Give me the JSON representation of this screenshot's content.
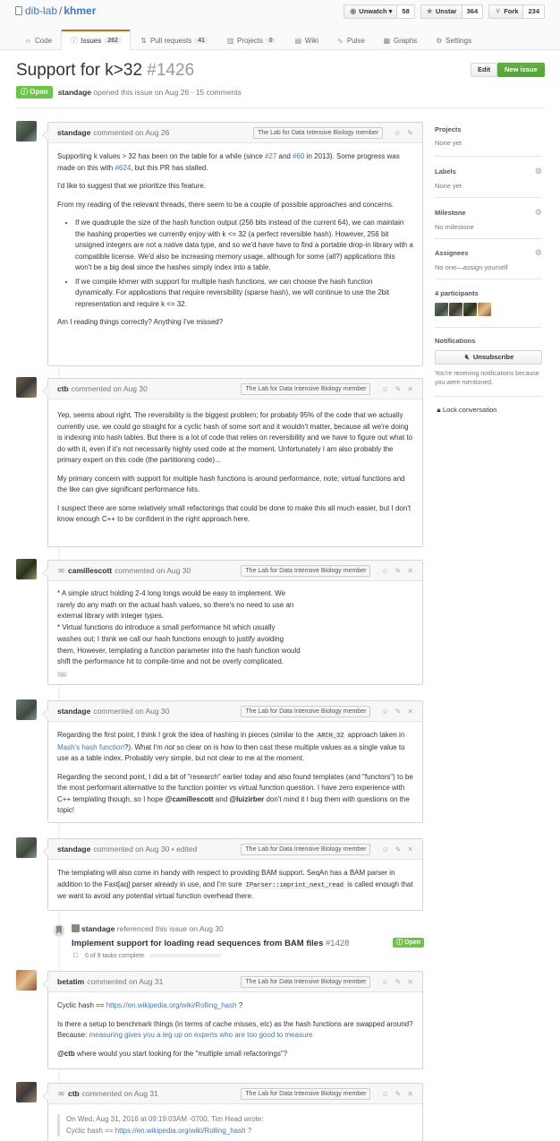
{
  "repo": {
    "owner": "dib-lab",
    "name": "khmer"
  },
  "actions": [
    {
      "label": "Unwatch",
      "count": "58",
      "icon": "eye-icon"
    },
    {
      "label": "Unstar",
      "count": "364",
      "icon": "star-icon"
    },
    {
      "label": "Fork",
      "count": "234",
      "icon": "fork-icon"
    }
  ],
  "nav": {
    "code": "Code",
    "issues": "Issues",
    "issues_count": "262",
    "pulls": "Pull requests",
    "pulls_count": "41",
    "projects": "Projects",
    "projects_count": "0",
    "wiki": "Wiki",
    "pulse": "Pulse",
    "graphs": "Graphs",
    "settings": "Settings"
  },
  "issue": {
    "title": "Support for k>32",
    "number": "#1426",
    "state": "Open",
    "author": "standage",
    "meta": "opened this issue on Aug 26 · 15 comments",
    "edit_label": "Edit",
    "new_issue_label": "New issue"
  },
  "member_label": "The Lab for Data Intensive Biology member",
  "comments": [
    {
      "author": "standage",
      "when": "commented on Aug 26",
      "p1_a": "Supporting k values > 32 has been on the table for a while (since ",
      "p1_link1": "#27",
      "p1_b": " and ",
      "p1_link2": "#60",
      "p1_c": " in 2013). Some progress was made on this with ",
      "p1_link3": "#624",
      "p1_d": ", but this PR has stalled.",
      "p2": "I'd like to suggest that we prioritize this feature.",
      "p3": "From my reading of the relevant threads, there seem to be a couple of possible approaches and concerns.",
      "li1": "If we quadruple the size of the hash function output (256 bits instead of the current 64), we can maintain the hashing properties we currently enjoy with k <= 32 (a perfect reversible hash). However, 256 bit unsigned integers are not a native data type, and so we'd have have to find a portable drop-in library with a compatible license. We'd also be increasing memory usage, although for some (all?) applications this won't be a big deal since the hashes simply index into a table.",
      "li2": "If we compile khmer with support for multiple hash functions, we can choose the hash function dynamically. For applications that require reversibility (sparse hash), we will continue to use the 2bit representation and require k <= 32.",
      "p4": "Am I reading things correctly? Anything I've missed?"
    },
    {
      "author": "ctb",
      "when": "commented on Aug 30",
      "p1": "Yep, seems about right. The reversibility is the biggest problem; for probably 95% of the code that we actually currently use, we could go straight for a cyclic hash of some sort and it wouldn't matter, because all we're doing is indexing into hash tables. But there is a lot of code that relies on reversibility and we have to figure out what to do with it, even if it's not necessarily highly used code at the moment. Unfortunately I am also probably the primary expert on this code (the partitioning code)...",
      "p2": "My primary concern with support for multiple hash functions is around performance, note; virtual functions and the like can give significant performance hits.",
      "p3": "I suspect there are some relatively small refactorings that could be done to make this all much easier, but I don't know enough C++ to be confident in the right approach here."
    },
    {
      "author": "camillescott",
      "when": "commented on Aug 30",
      "l1": "* A simple struct holding 2-4 long longs would be easy to implement. We",
      "l2": "rarely do any math on the actual hash values, so there's no need to use an",
      "l3": "external library with integer types.",
      "l4": "* Virtual functions do introduce a small performance hit which usually",
      "l5": "washes out; I think we call our hash functions enough to justify avoiding",
      "l6": "them, However, templating a function parameter into the hash function would",
      "l7": "shift the performance hit to compile-time and not be overly complicated.",
      "more": "..."
    },
    {
      "author": "standage",
      "when": "commented on Aug 30",
      "p1_a": "Regarding the first point, I think I grok the idea of hashing in pieces (similar to the ",
      "p1_code": "ARCH_32",
      "p1_b": " approach taken in ",
      "p1_link": "Mash's hash function",
      "p1_c": "?). What I'm ",
      "p1_em": "not",
      "p1_d": " so clear on is how to then cast these multiple values as a single value to use as a table index. Probably very simple, but not clear to me at the moment.",
      "p2_a": "Regarding the second point, I did a bit of \"research\" earlier today and also found templates (and \"functors\") to be the most performant alternative to the function pointer vs virtual function question. I have zero experience with C++ templating though, so I hope ",
      "p2_m1": "@camillescott",
      "p2_b": " and ",
      "p2_m2": "@luizirber",
      "p2_c": " don't mind it I bug them with questions on the topic!"
    },
    {
      "author": "standage",
      "when": "commented on Aug 30 • edited",
      "p1_a": "The templating will also come in handy with respect to providing BAM support. SeqAn has a BAM parser in addition to the Fast[aq] parser already in use, and I'm sure ",
      "p1_code": "IParser::imprint_next_read",
      "p1_b": " is called enough that we want to avoid any potential virtual function overhead there."
    },
    {
      "author": "betatim",
      "when": "commented on Aug 31",
      "p1_a": "Cyclic hash == ",
      "p1_link": "https://en.wikipedia.org/wiki/Rolling_hash",
      "p1_b": " ?",
      "p2_a": "Is there a setup to benchmark things (in terms of cache misses, etc) as the hash functions are swapped around? Because: ",
      "p2_link": "measuring gives you a leg up on experts who are too good to measure",
      "p3_m": "@ctb",
      "p3_b": " where would you start looking for the \"multiple small refactorings\"?"
    },
    {
      "author": "ctb",
      "when": "commented on Aug 31",
      "q1": "On Wed, Aug 31, 2016 at 09:19:03AM -0700, Tim Head wrote:",
      "q2_a": "Cyclic hash == ",
      "q2_link": "https://en.wikipedia.org/wiki/Rolling_hash",
      "q2_b": " ?"
    }
  ],
  "xref": {
    "author": "standage",
    "text": "referenced this issue on Aug 30",
    "title": "Implement support for loading read sequences from BAM files",
    "number": "#1428",
    "state": "Open",
    "tasks": "0 of 9 tasks complete"
  },
  "sidebar": {
    "projects_heading": "Projects",
    "projects_value": "None yet",
    "labels_heading": "Labels",
    "labels_value": "None yet",
    "milestone_heading": "Milestone",
    "milestone_value": "No milestone",
    "assignees_heading": "Assignees",
    "assignees_value": "No one—assign yourself",
    "participants_heading": "4 participants",
    "notifications_heading": "Notifications",
    "unsubscribe_label": "Unsubscribe",
    "notify_note": "You're receiving notifications because you were mentioned.",
    "lock_label": "Lock conversation"
  },
  "colors": {
    "link": "#4078c0",
    "open_green": "#6cc644",
    "new_issue_green": "#60b044",
    "selected_tab": "#d26911"
  }
}
